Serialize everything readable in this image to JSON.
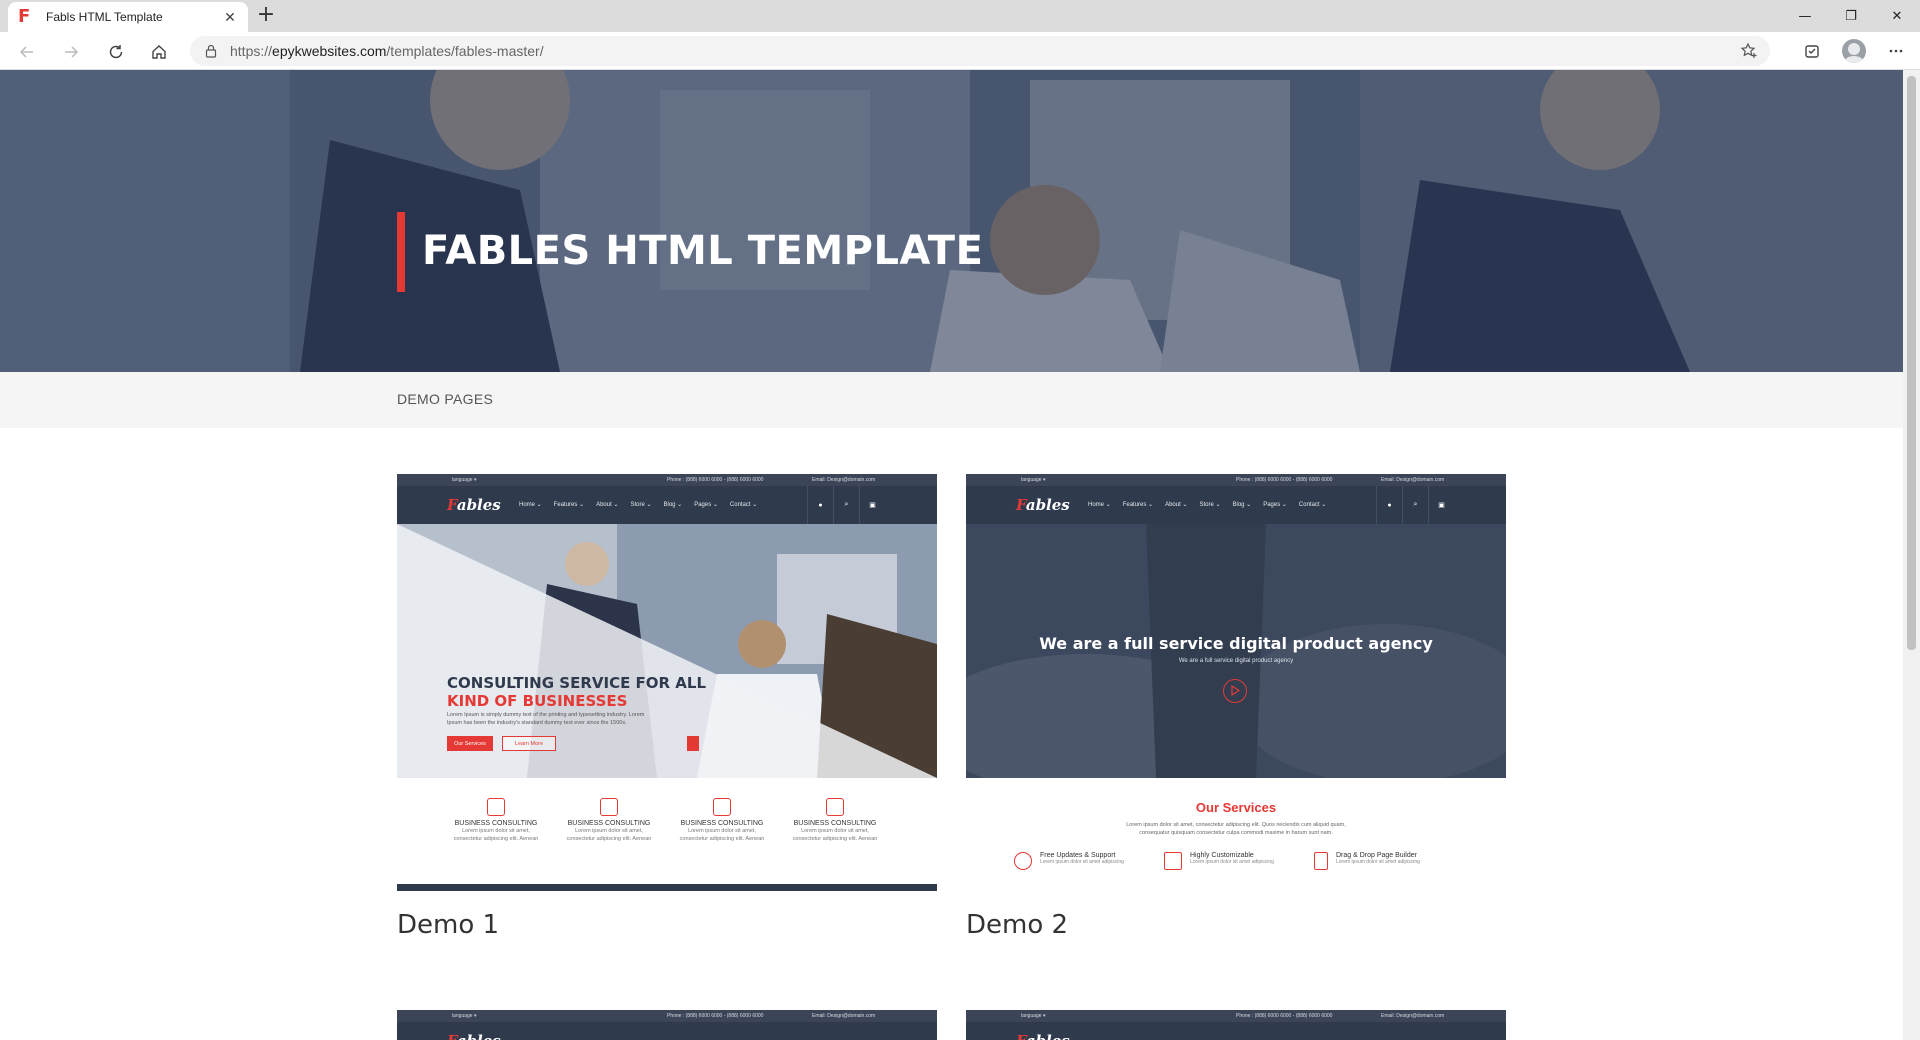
{
  "browser": {
    "tab_title": "Fabls HTML Template",
    "tab_favicon": "F",
    "url_scheme": "https://",
    "url_host": "epykwebsites.com",
    "url_path": "/templates/fables-master/"
  },
  "hero": {
    "title": "FABLES HTML TEMPLATE",
    "accent_color": "#e53935"
  },
  "subbar": {
    "label": "DEMO PAGES"
  },
  "mini_site": {
    "language": "language ▾",
    "phone": "Phone : (888) 6000 6000 - (888) 6000 6000",
    "email": "Email: Design@domain.com",
    "logo_first": "F",
    "logo_rest": "ables",
    "menu": [
      "Home ⌄",
      "Features ⌄",
      "About ⌄",
      "Store ⌄",
      "Blog ⌄",
      "Pages ⌄",
      "Contact ⌄"
    ]
  },
  "demo1": {
    "name": "Demo 1",
    "headline_1": "CONSULTING SERVICE FOR ALL",
    "headline_2": "KIND OF BUSINESSES",
    "body_1": "Lorem Ipsum is simply dummy text of the printing and typesetting industry. Lorem",
    "body_2": "Ipsum has been the industry's standard dummy text ever since the 1500s.",
    "btn_primary": "Our Services",
    "btn_secondary": "Learn More",
    "services": [
      {
        "title": "BUSINESS CONSULTING",
        "text_1": "Lorem ipsum dolor sit amet,",
        "text_2": "consectetur adipiscing elit. Aenean"
      },
      {
        "title": "BUSINESS CONSULTING",
        "text_1": "Lorem ipsum dolor sit amet,",
        "text_2": "consectetur adipiscing elit. Aenean"
      },
      {
        "title": "BUSINESS CONSULTING",
        "text_1": "Lorem ipsum dolor sit amet,",
        "text_2": "consectetur adipiscing elit. Aenean"
      },
      {
        "title": "BUSINESS CONSULTING",
        "text_1": "Lorem ipsum dolor sit amet,",
        "text_2": "consectetur adipiscing elit. Aenean"
      }
    ]
  },
  "demo2": {
    "name": "Demo 2",
    "headline": "We are a full service digital product agency",
    "subline": "We are a full service digital product agency",
    "services_title": "Our Services",
    "services_text_1": "Lorem ipsum dolor sit amet, consectetur adipiscing elit. Quos reiciendis cum aliquid quam,",
    "services_text_2": "consequatur quisquam consectetur culpa commodi maxime in harum sunt nam.",
    "features": [
      {
        "title": "Free Updates & Support",
        "text": "Lorem ipsum dolor sit amet adipiscing"
      },
      {
        "title": "Highly Customizable",
        "text": "Lorem ipsum dolor sit amet adipiscing"
      },
      {
        "title": "Drag & Drop Page Builder",
        "text": "Lorem ipsum dolor sit amet adipiscing"
      }
    ]
  }
}
